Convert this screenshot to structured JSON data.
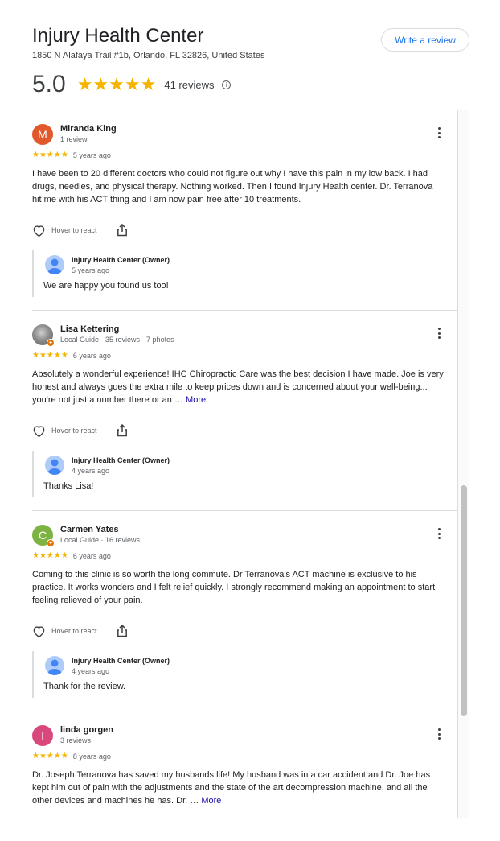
{
  "business": {
    "name": "Injury Health Center",
    "address": "1850 N Alafaya Trail #1b, Orlando, FL 32826, United States",
    "write_review_label": "Write a review",
    "rating": "5.0",
    "rating_stars": "★★★★★",
    "review_count": "41 reviews",
    "info_icon": "i"
  },
  "reviews": [
    {
      "initial": "M",
      "avatar_color": "#e2582d",
      "name": "Miranda King",
      "meta": "1 review",
      "stars": "★★★★★",
      "date": "5 years ago",
      "text": "I have been to 20 different doctors who could not figure out why I have this pain in my low back. I had drugs, needles, and physical therapy. Nothing worked. Then I found Injury Health center. Dr. Terranova hit me with his ACT thing and I am now pain free after 10 treatments.",
      "more": "",
      "react_label": "Hover to react",
      "owner": {
        "name": "Injury Health Center (Owner)",
        "date": "5 years ago",
        "text": "We are happy you found us too!"
      }
    },
    {
      "initial": "",
      "avatar_color": "#8d8d8d",
      "name": "Lisa Kettering",
      "meta": "Local Guide · 35 reviews · 7 photos",
      "stars": "★★★★★",
      "date": "6 years ago",
      "text": "Absolutely a wonderful experience! IHC Chiropractic Care was the best decision I have made. Joe is very honest and always goes the extra mile to keep prices down and is concerned about your well-being... you're not just a number there or an …",
      "more": "More",
      "react_label": "Hover to react",
      "owner": {
        "name": "Injury Health Center (Owner)",
        "date": "4 years ago",
        "text": "Thanks Lisa!"
      }
    },
    {
      "initial": "C",
      "avatar_color": "#7cb342",
      "name": "Carmen Yates",
      "meta": "Local Guide · 16 reviews",
      "stars": "★★★★★",
      "date": "6 years ago",
      "text": "Coming to this clinic is so worth the long commute. Dr Terranova's ACT machine is exclusive to his practice. It works wonders and I felt relief quickly. I strongly recommend making an appointment to start feeling relieved of your pain.",
      "more": "",
      "react_label": "Hover to react",
      "owner": {
        "name": "Injury Health Center (Owner)",
        "date": "4 years ago",
        "text": "Thank for the review."
      }
    },
    {
      "initial": "l",
      "avatar_color": "#d9487c",
      "name": "linda gorgen",
      "meta": "3 reviews",
      "stars": "★★★★★",
      "date": "8 years ago",
      "text": "Dr. Joseph Terranova has saved my husbands life! My husband was in a car accident and Dr. Joe has kept him out of pain with the adjustments and the state of the art decompression machine, and all the other devices and machines he has. Dr. …",
      "more": "More",
      "react_label": "",
      "owner": null
    }
  ],
  "guide_badge": "✦"
}
